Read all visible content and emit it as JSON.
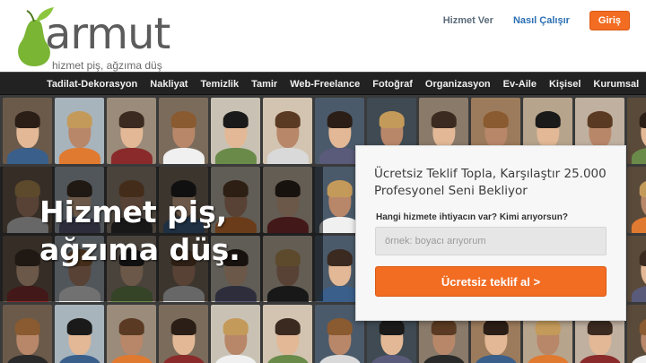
{
  "brand": {
    "name": "armut",
    "tagline": "hizmet piş, ağzıma düş",
    "accent_color": "#f26c22",
    "leaf_color": "#7ab534"
  },
  "header": {
    "links": [
      {
        "label": "Hizmet Ver"
      },
      {
        "label": "Nasıl Çalışır"
      }
    ],
    "login_label": "Giriş"
  },
  "nav": {
    "items": [
      {
        "label": "Tadilat-Dekorasyon"
      },
      {
        "label": "Nakliyat"
      },
      {
        "label": "Temizlik"
      },
      {
        "label": "Tamir"
      },
      {
        "label": "Web-Freelance"
      },
      {
        "label": "Fotoğraf"
      },
      {
        "label": "Organizasyon"
      },
      {
        "label": "Ev-Aile"
      },
      {
        "label": "Kişisel"
      },
      {
        "label": "Kurumsal"
      }
    ]
  },
  "hero": {
    "title_line1": "Hizmet piş,",
    "title_line2": "ağzıma düş."
  },
  "form": {
    "title": "Ücretsiz Teklif Topla, Karşılaştır 25.000 Profesyonel Seni Bekliyor",
    "label": "Hangi hizmete ihtiyacın var? Kimi arıyorsun?",
    "placeholder": "örnek: boyacı arıyorum",
    "value": "",
    "button_label": "Ücretsiz teklif al >"
  }
}
